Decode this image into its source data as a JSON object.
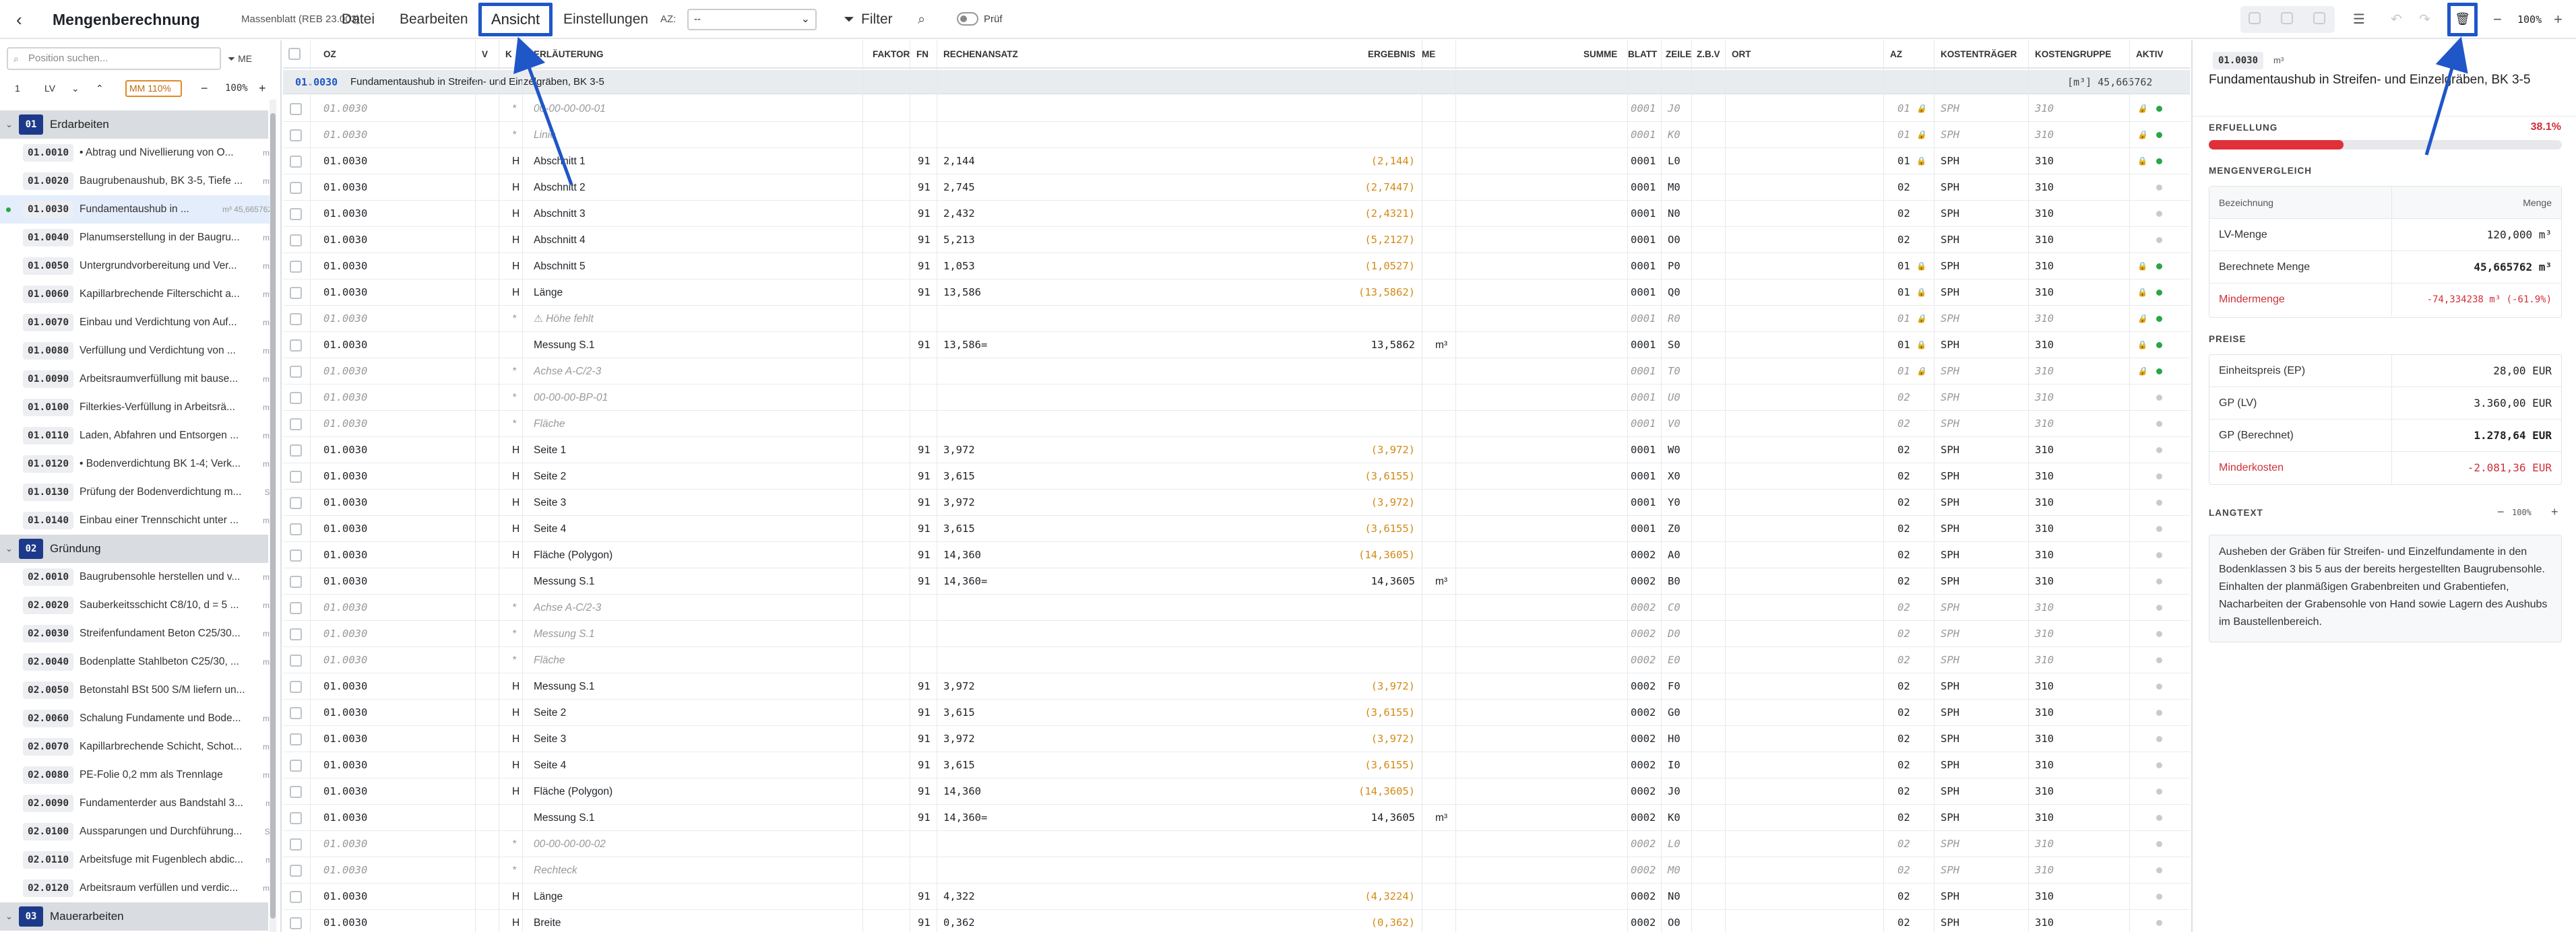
{
  "header": {
    "back": "‹",
    "title": "Mengenberechnung",
    "subtitle": "Massenblatt (REB 23.003)",
    "menu": [
      "Datei",
      "Bearbeiten",
      "Ansicht",
      "Einstellungen"
    ],
    "az_label": "AZ:",
    "az_value": "--",
    "filter": "Filter",
    "pruf": "Prüf",
    "zoom": "100%",
    "accent": "#1f56c8"
  },
  "left": {
    "search_placeholder": "Position suchen...",
    "me_button": "ME",
    "level": "1",
    "mode": "LV",
    "mm_value": "MM 110%",
    "zoom": "100%",
    "groups": [
      {
        "code": "01",
        "name": "Erdarbeiten",
        "items": [
          {
            "code": "01.0010",
            "text": "• Abtrag und Nivellierung von O...",
            "unit": "m²"
          },
          {
            "code": "01.0020",
            "text": "Baugrubenaushub, BK 3-5, Tiefe ...",
            "unit": "m³"
          },
          {
            "code": "01.0030",
            "text": "Fundamentaushub in ...",
            "unit": "m³ 45,665762"
          },
          {
            "code": "01.0040",
            "text": "Planumserstellung in der Baugru...",
            "unit": "m²"
          },
          {
            "code": "01.0050",
            "text": "Untergrundvorbereitung und Ver...",
            "unit": "m²"
          },
          {
            "code": "01.0060",
            "text": "Kapillarbrechende Filterschicht a...",
            "unit": "m²"
          },
          {
            "code": "01.0070",
            "text": "Einbau und Verdichtung von Auf...",
            "unit": "m³"
          },
          {
            "code": "01.0080",
            "text": "Verfüllung und Verdichtung von ...",
            "unit": "m³"
          },
          {
            "code": "01.0090",
            "text": "Arbeitsraumverfüllung mit bause...",
            "unit": "m³"
          },
          {
            "code": "01.0100",
            "text": "Filterkies-Verfüllung in Arbeitsrä...",
            "unit": "m³"
          },
          {
            "code": "01.0110",
            "text": "Laden, Abfahren und Entsorgen ...",
            "unit": "m³"
          },
          {
            "code": "01.0120",
            "text": "• Bodenverdichtung BK 1-4; Verk...",
            "unit": "m²"
          },
          {
            "code": "01.0130",
            "text": "Prüfung der Bodenverdichtung m...",
            "unit": "St"
          },
          {
            "code": "01.0140",
            "text": "Einbau einer Trennschicht unter ...",
            "unit": "m²"
          }
        ]
      },
      {
        "code": "02",
        "name": "Gründung",
        "items": [
          {
            "code": "02.0010",
            "text": "Baugrubensohle herstellen und v...",
            "unit": "m²"
          },
          {
            "code": "02.0020",
            "text": "Sauberkeitsschicht C8/10, d = 5 ...",
            "unit": "m²"
          },
          {
            "code": "02.0030",
            "text": "Streifenfundament Beton C25/30...",
            "unit": "m³"
          },
          {
            "code": "02.0040",
            "text": "Bodenplatte Stahlbeton C25/30, ...",
            "unit": "m³"
          },
          {
            "code": "02.0050",
            "text": "Betonstahl BSt 500 S/M liefern un...",
            "unit": "t"
          },
          {
            "code": "02.0060",
            "text": "Schalung Fundamente und Bode...",
            "unit": "m²"
          },
          {
            "code": "02.0070",
            "text": "Kapillarbrechende Schicht, Schot...",
            "unit": "m²"
          },
          {
            "code": "02.0080",
            "text": "PE-Folie 0,2 mm als Trennlage",
            "unit": "m²"
          },
          {
            "code": "02.0090",
            "text": "Fundamenterder aus Bandstahl 3...",
            "unit": "m"
          },
          {
            "code": "02.0100",
            "text": "Aussparungen und Durchführung...",
            "unit": "St"
          },
          {
            "code": "02.0110",
            "text": "Arbeitsfuge mit Fugenblech abdic...",
            "unit": "m"
          },
          {
            "code": "02.0120",
            "text": "Arbeitsraum verfüllen und verdic...",
            "unit": "m³"
          }
        ]
      },
      {
        "code": "03",
        "name": "Mauerarbeiten",
        "items": []
      }
    ]
  },
  "table": {
    "headers": {
      "oz": "OZ",
      "v": "V",
      "k": "K",
      "erl": "ERLÄUTERUNG",
      "faktor": "FAKTOR",
      "fn": "FN",
      "rech": "RECHENANSATZ",
      "erg": "ERGEBNIS",
      "me": "ME",
      "summe": "SUMME",
      "blatt": "BLATT",
      "zeile": "ZEILE",
      "zbv": "Z.B.V",
      "ort": "ORT",
      "az": "AZ",
      "kt": "KOSTENTRÄGER",
      "kg": "KOSTENGRUPPE",
      "aktiv": "AKTIV"
    },
    "group": {
      "code": "01.0030",
      "title": "Fundamentaushub in Streifen- und Einzelgräben, BK 3-5",
      "sum": "[m³] 45,665762"
    },
    "rows": [
      {
        "oz": "01.0030",
        "k": "*",
        "erl": "00-00-00-00-01",
        "fn": "",
        "rech": "",
        "erg": "",
        "me": "",
        "blatt": "0001",
        "zeile": "J0",
        "az": "01",
        "kt": "SPH",
        "kg": "310",
        "it": true,
        "lock": true,
        "active": true
      },
      {
        "oz": "01.0030",
        "k": "*",
        "erl": "Linie",
        "fn": "",
        "rech": "",
        "erg": "",
        "me": "",
        "blatt": "0001",
        "zeile": "K0",
        "az": "01",
        "kt": "SPH",
        "kg": "310",
        "it": true,
        "lock": true,
        "active": true
      },
      {
        "oz": "01.0030",
        "k": "H",
        "erl": "Abschnitt 1",
        "fn": "91",
        "rech": "2,144",
        "erg": "(2,144)",
        "me": "",
        "blatt": "0001",
        "zeile": "L0",
        "az": "01",
        "kt": "SPH",
        "kg": "310",
        "it": false,
        "lock": true,
        "active": true
      },
      {
        "oz": "01.0030",
        "k": "H",
        "erl": "Abschnitt 2",
        "fn": "91",
        "rech": "2,745",
        "erg": "(2,7447)",
        "me": "",
        "blatt": "0001",
        "zeile": "M0",
        "az": "02",
        "kt": "SPH",
        "kg": "310",
        "it": false,
        "lock": false,
        "active": false
      },
      {
        "oz": "01.0030",
        "k": "H",
        "erl": "Abschnitt 3",
        "fn": "91",
        "rech": "2,432",
        "erg": "(2,4321)",
        "me": "",
        "blatt": "0001",
        "zeile": "N0",
        "az": "02",
        "kt": "SPH",
        "kg": "310",
        "it": false,
        "lock": false,
        "active": false
      },
      {
        "oz": "01.0030",
        "k": "H",
        "erl": "Abschnitt 4",
        "fn": "91",
        "rech": "5,213",
        "erg": "(5,2127)",
        "me": "",
        "blatt": "0001",
        "zeile": "O0",
        "az": "02",
        "kt": "SPH",
        "kg": "310",
        "it": false,
        "lock": false,
        "active": false
      },
      {
        "oz": "01.0030",
        "k": "H",
        "erl": "Abschnitt 5",
        "fn": "91",
        "rech": "1,053",
        "erg": "(1,0527)",
        "me": "",
        "blatt": "0001",
        "zeile": "P0",
        "az": "01",
        "kt": "SPH",
        "kg": "310",
        "it": false,
        "lock": true,
        "active": true
      },
      {
        "oz": "01.0030",
        "k": "H",
        "erl": "Länge",
        "fn": "91",
        "rech": "13,586",
        "erg": "(13,5862)",
        "me": "",
        "blatt": "0001",
        "zeile": "Q0",
        "az": "01",
        "kt": "SPH",
        "kg": "310",
        "it": false,
        "lock": true,
        "active": true
      },
      {
        "oz": "01.0030",
        "k": "*",
        "erl": "⚠ Höhe fehlt",
        "fn": "",
        "rech": "",
        "erg": "",
        "me": "",
        "blatt": "0001",
        "zeile": "R0",
        "az": "01",
        "kt": "SPH",
        "kg": "310",
        "it": true,
        "lock": true,
        "active": true
      },
      {
        "oz": "01.0030",
        "k": "",
        "erl": "Messung S.1",
        "fn": "91",
        "rech": "13,586=",
        "erg": "13,5862",
        "me": "m³",
        "blatt": "0001",
        "zeile": "S0",
        "az": "01",
        "kt": "SPH",
        "kg": "310",
        "it": false,
        "dark": true,
        "lock": true,
        "active": true
      },
      {
        "oz": "01.0030",
        "k": "*",
        "erl": "Achse A-C/2-3",
        "fn": "",
        "rech": "",
        "erg": "",
        "me": "",
        "blatt": "0001",
        "zeile": "T0",
        "az": "01",
        "kt": "SPH",
        "kg": "310",
        "it": true,
        "lock": true,
        "active": true
      },
      {
        "oz": "01.0030",
        "k": "*",
        "erl": "00-00-00-BP-01",
        "fn": "",
        "rech": "",
        "erg": "",
        "me": "",
        "blatt": "0001",
        "zeile": "U0",
        "az": "02",
        "kt": "SPH",
        "kg": "310",
        "it": true,
        "lock": false,
        "active": false
      },
      {
        "oz": "01.0030",
        "k": "*",
        "erl": "Fläche",
        "fn": "",
        "rech": "",
        "erg": "",
        "me": "",
        "blatt": "0001",
        "zeile": "V0",
        "az": "02",
        "kt": "SPH",
        "kg": "310",
        "it": true,
        "lock": false,
        "active": false
      },
      {
        "oz": "01.0030",
        "k": "H",
        "erl": "Seite 1",
        "fn": "91",
        "rech": "3,972",
        "erg": "(3,972)",
        "me": "",
        "blatt": "0001",
        "zeile": "W0",
        "az": "02",
        "kt": "SPH",
        "kg": "310",
        "it": false,
        "lock": false,
        "active": false
      },
      {
        "oz": "01.0030",
        "k": "H",
        "erl": "Seite 2",
        "fn": "91",
        "rech": "3,615",
        "erg": "(3,6155)",
        "me": "",
        "blatt": "0001",
        "zeile": "X0",
        "az": "02",
        "kt": "SPH",
        "kg": "310",
        "it": false,
        "lock": false,
        "active": false
      },
      {
        "oz": "01.0030",
        "k": "H",
        "erl": "Seite 3",
        "fn": "91",
        "rech": "3,972",
        "erg": "(3,972)",
        "me": "",
        "blatt": "0001",
        "zeile": "Y0",
        "az": "02",
        "kt": "SPH",
        "kg": "310",
        "it": false,
        "lock": false,
        "active": false
      },
      {
        "oz": "01.0030",
        "k": "H",
        "erl": "Seite 4",
        "fn": "91",
        "rech": "3,615",
        "erg": "(3,6155)",
        "me": "",
        "blatt": "0001",
        "zeile": "Z0",
        "az": "02",
        "kt": "SPH",
        "kg": "310",
        "it": false,
        "lock": false,
        "active": false
      },
      {
        "oz": "01.0030",
        "k": "H",
        "erl": "Fläche (Polygon)",
        "fn": "91",
        "rech": "14,360",
        "erg": "(14,3605)",
        "me": "",
        "blatt": "0002",
        "zeile": "A0",
        "az": "02",
        "kt": "SPH",
        "kg": "310",
        "it": false,
        "lock": false,
        "active": false
      },
      {
        "oz": "01.0030",
        "k": "",
        "erl": "Messung S.1",
        "fn": "91",
        "rech": "14,360=",
        "erg": "14,3605",
        "me": "m³",
        "blatt": "0002",
        "zeile": "B0",
        "az": "02",
        "kt": "SPH",
        "kg": "310",
        "it": false,
        "dark": true,
        "lock": false,
        "active": false
      },
      {
        "oz": "01.0030",
        "k": "*",
        "erl": "Achse A-C/2-3",
        "fn": "",
        "rech": "",
        "erg": "",
        "me": "",
        "blatt": "0002",
        "zeile": "C0",
        "az": "02",
        "kt": "SPH",
        "kg": "310",
        "it": true,
        "lock": false,
        "active": false
      },
      {
        "oz": "01.0030",
        "k": "*",
        "erl": "Messung S.1",
        "fn": "",
        "rech": "",
        "erg": "",
        "me": "",
        "blatt": "0002",
        "zeile": "D0",
        "az": "02",
        "kt": "SPH",
        "kg": "310",
        "it": true,
        "lock": false,
        "active": false
      },
      {
        "oz": "01.0030",
        "k": "*",
        "erl": "Fläche",
        "fn": "",
        "rech": "",
        "erg": "",
        "me": "",
        "blatt": "0002",
        "zeile": "E0",
        "az": "02",
        "kt": "SPH",
        "kg": "310",
        "it": true,
        "lock": false,
        "active": false
      },
      {
        "oz": "01.0030",
        "k": "H",
        "erl": "Messung S.1",
        "fn": "91",
        "rech": "3,972",
        "erg": "(3,972)",
        "me": "",
        "blatt": "0002",
        "zeile": "F0",
        "az": "02",
        "kt": "SPH",
        "kg": "310",
        "it": false,
        "lock": false,
        "active": false
      },
      {
        "oz": "01.0030",
        "k": "H",
        "erl": "Seite 2",
        "fn": "91",
        "rech": "3,615",
        "erg": "(3,6155)",
        "me": "",
        "blatt": "0002",
        "zeile": "G0",
        "az": "02",
        "kt": "SPH",
        "kg": "310",
        "it": false,
        "lock": false,
        "active": false
      },
      {
        "oz": "01.0030",
        "k": "H",
        "erl": "Seite 3",
        "fn": "91",
        "rech": "3,972",
        "erg": "(3,972)",
        "me": "",
        "blatt": "0002",
        "zeile": "H0",
        "az": "02",
        "kt": "SPH",
        "kg": "310",
        "it": false,
        "lock": false,
        "active": false
      },
      {
        "oz": "01.0030",
        "k": "H",
        "erl": "Seite 4",
        "fn": "91",
        "rech": "3,615",
        "erg": "(3,6155)",
        "me": "",
        "blatt": "0002",
        "zeile": "I0",
        "az": "02",
        "kt": "SPH",
        "kg": "310",
        "it": false,
        "lock": false,
        "active": false
      },
      {
        "oz": "01.0030",
        "k": "H",
        "erl": "Fläche (Polygon)",
        "fn": "91",
        "rech": "14,360",
        "erg": "(14,3605)",
        "me": "",
        "blatt": "0002",
        "zeile": "J0",
        "az": "02",
        "kt": "SPH",
        "kg": "310",
        "it": false,
        "lock": false,
        "active": false
      },
      {
        "oz": "01.0030",
        "k": "",
        "erl": "Messung S.1",
        "fn": "91",
        "rech": "14,360=",
        "erg": "14,3605",
        "me": "m³",
        "blatt": "0002",
        "zeile": "K0",
        "az": "02",
        "kt": "SPH",
        "kg": "310",
        "it": false,
        "dark": true,
        "lock": false,
        "active": false
      },
      {
        "oz": "01.0030",
        "k": "*",
        "erl": "00-00-00-00-02",
        "fn": "",
        "rech": "",
        "erg": "",
        "me": "",
        "blatt": "0002",
        "zeile": "L0",
        "az": "02",
        "kt": "SPH",
        "kg": "310",
        "it": true,
        "lock": false,
        "active": false
      },
      {
        "oz": "01.0030",
        "k": "*",
        "erl": "Rechteck",
        "fn": "",
        "rech": "",
        "erg": "",
        "me": "",
        "blatt": "0002",
        "zeile": "M0",
        "az": "02",
        "kt": "SPH",
        "kg": "310",
        "it": true,
        "lock": false,
        "active": false
      },
      {
        "oz": "01.0030",
        "k": "H",
        "erl": "Länge",
        "fn": "91",
        "rech": "4,322",
        "erg": "(4,3224)",
        "me": "",
        "blatt": "0002",
        "zeile": "N0",
        "az": "02",
        "kt": "SPH",
        "kg": "310",
        "it": false,
        "lock": false,
        "active": false
      },
      {
        "oz": "01.0030",
        "k": "H",
        "erl": "Breite",
        "fn": "91",
        "rech": "0,362",
        "erg": "(0,362)",
        "me": "",
        "blatt": "0002",
        "zeile": "O0",
        "az": "02",
        "kt": "SPH",
        "kg": "310",
        "it": false,
        "lock": false,
        "active": false
      }
    ]
  },
  "right": {
    "code": "01.0030",
    "unit": "m³",
    "title": "Fundamentaushub in Streifen- und Einzelgräben, BK 3-5",
    "erfuellung_label": "ERFUELLUNG",
    "erfuellung_value": "38.1%",
    "erfuellung_fraction": 0.381,
    "mengen_label": "MENGENVERGLEICH",
    "mengen_head": [
      "Bezeichnung",
      "Menge"
    ],
    "mengen": [
      {
        "l": "LV-Menge",
        "v": "120,000 m³"
      },
      {
        "l": "Berechnete Menge",
        "v": "45,665762 m³"
      },
      {
        "l": "Mindermenge",
        "v": "-74,334238 m³ (-61.9%)"
      }
    ],
    "preise_label": "PREISE",
    "preise": [
      {
        "l": "Einheitspreis (EP)",
        "v": "28,00 EUR"
      },
      {
        "l": "GP (LV)",
        "v": "3.360,00 EUR"
      },
      {
        "l": "GP (Berechnet)",
        "v": "1.278,64 EUR"
      },
      {
        "l": "Minderkosten",
        "v": "-2.081,36 EUR"
      }
    ],
    "langtext_label": "LANGTEXT",
    "langtext_zoom": "100%",
    "langtext": "Ausheben der Gräben für Streifen- und Einzelfundamente in den Bodenklassen 3 bis 5 aus der bereits hergestellten Baugrubensohle. Einhalten der planmäßigen Grabenbreiten und Grabentiefen, Nacharbeiten der Grabensohle von Hand sowie Lagern des Aushubs im Baustellenbereich."
  }
}
